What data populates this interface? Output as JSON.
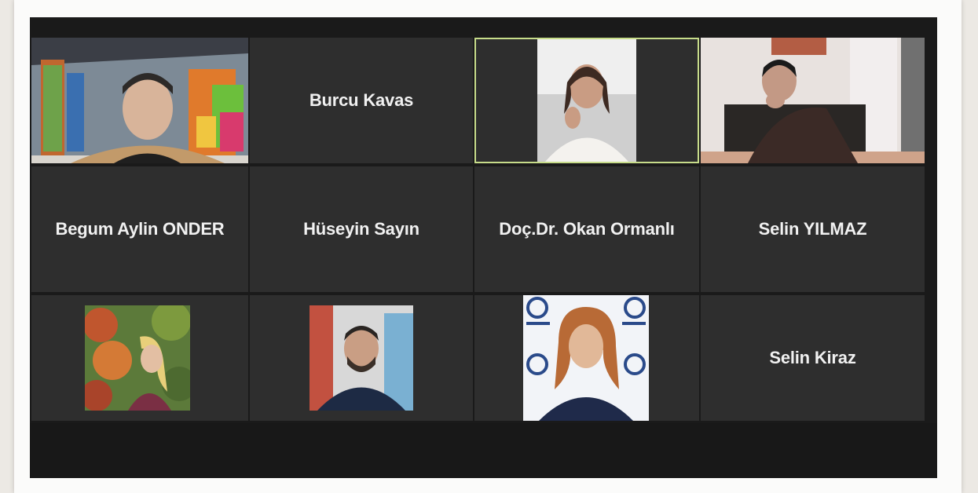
{
  "participants": [
    {
      "name": "",
      "video": "office-man",
      "active": false
    },
    {
      "name": "Burcu Kavas",
      "video": null,
      "active": false
    },
    {
      "name": "",
      "video": "woman-white-shirt",
      "active": true
    },
    {
      "name": "",
      "video": "young-man-sofa",
      "active": false
    },
    {
      "name": "Begum Aylin ONDER",
      "video": null,
      "active": false
    },
    {
      "name": "Hüseyin Sayın",
      "video": null,
      "active": false
    },
    {
      "name": "Doç.Dr. Okan Ormanlı",
      "video": null,
      "active": false
    },
    {
      "name": "Selin YILMAZ",
      "video": null,
      "active": false
    },
    {
      "name": "",
      "video": "profile-blonde-woman",
      "active": false
    },
    {
      "name": "",
      "video": "profile-bearded-man",
      "active": false
    },
    {
      "name": "",
      "video": "profile-woman-logo-backdrop",
      "active": false
    },
    {
      "name": "Selin Kiraz",
      "video": null,
      "active": false
    }
  ],
  "colors": {
    "tile_bg": "#2e2e2e",
    "window_bg": "#1a1a1a",
    "active_speaker_border": "#c7dc8a",
    "name_text": "#f1f1f1"
  }
}
